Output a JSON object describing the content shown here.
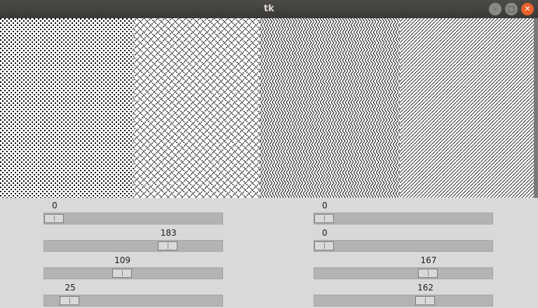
{
  "window": {
    "title": "tk",
    "minimize_glyph": "–",
    "maximize_glyph": "□",
    "close_glyph": "✕"
  },
  "sliders": [
    {
      "value": 0,
      "min": 0,
      "max": 255
    },
    {
      "value": 183,
      "min": 0,
      "max": 255
    },
    {
      "value": 109,
      "min": 0,
      "max": 255
    },
    {
      "value": 25,
      "min": 0,
      "max": 255
    },
    {
      "value": 0,
      "min": 0,
      "max": 255
    },
    {
      "value": 0,
      "min": 0,
      "max": 255
    },
    {
      "value": 167,
      "min": 0,
      "max": 255
    },
    {
      "value": 162,
      "min": 0,
      "max": 255
    }
  ]
}
